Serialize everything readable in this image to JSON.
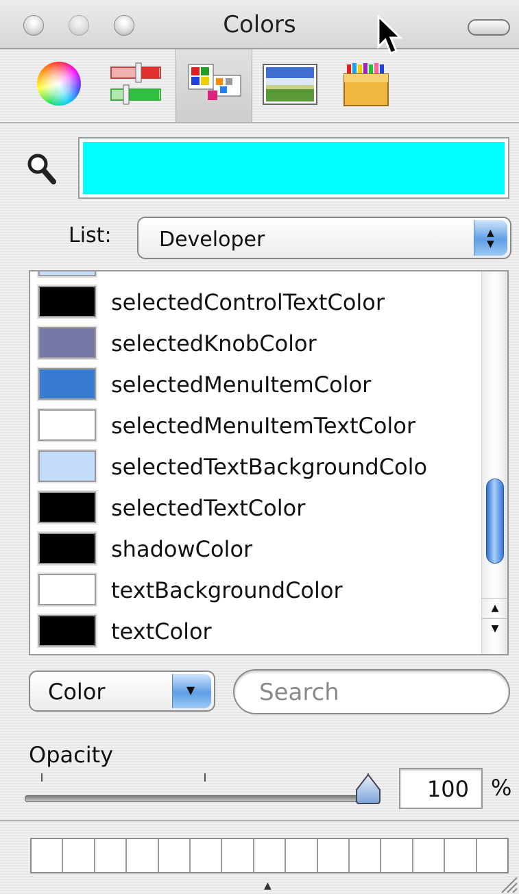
{
  "window": {
    "title": "Colors"
  },
  "toolbar": {
    "items": [
      {
        "name": "color-wheel",
        "selected": false
      },
      {
        "name": "color-sliders",
        "selected": false
      },
      {
        "name": "color-palettes",
        "selected": true
      },
      {
        "name": "image-palettes",
        "selected": false
      },
      {
        "name": "crayons",
        "selected": false
      }
    ]
  },
  "current_color": "#00FFFF",
  "list": {
    "label": "List:",
    "selected": "Developer",
    "items": [
      {
        "label": "selectedControlTextColor",
        "color": "#000000"
      },
      {
        "label": "selectedKnobColor",
        "color": "#7777A5"
      },
      {
        "label": "selectedMenuItemColor",
        "color": "#3A7BD2"
      },
      {
        "label": "selectedMenuItemTextColor",
        "color": "#FFFFFF"
      },
      {
        "label": "selectedTextBackgroundColo",
        "color": "#C4DCFB"
      },
      {
        "label": "selectedTextColor",
        "color": "#000000"
      },
      {
        "label": "shadowColor",
        "color": "#000000"
      },
      {
        "label": "textBackgroundColor",
        "color": "#FFFFFF"
      },
      {
        "label": "textColor",
        "color": "#000000"
      }
    ]
  },
  "mode_popup": {
    "selected": "Color"
  },
  "search": {
    "placeholder": "Search",
    "value": ""
  },
  "opacity": {
    "label": "Opacity",
    "value": "100",
    "unit": "%",
    "fraction": 1.0
  }
}
